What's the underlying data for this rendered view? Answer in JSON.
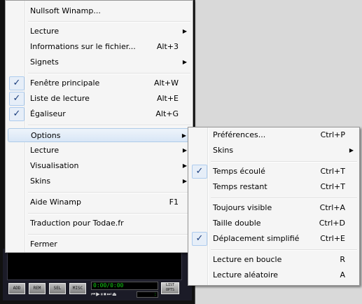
{
  "winamp": {
    "buttons": [
      "ADD",
      "REM",
      "SEL",
      "MISC"
    ],
    "time_display": "0:00/0:00",
    "list_label": "LIST OPTS"
  },
  "main_menu": {
    "items": [
      {
        "label": "Nullsoft Winamp...",
        "shortcut": "",
        "submenu": false,
        "checked": false
      },
      {
        "label": "Lecture",
        "shortcut": "",
        "submenu": true,
        "checked": false
      },
      {
        "label": "Informations sur le fichier...",
        "shortcut": "Alt+3",
        "submenu": false,
        "checked": false
      },
      {
        "label": "Signets",
        "shortcut": "",
        "submenu": true,
        "checked": false
      },
      {
        "label": "Fenêtre principale",
        "shortcut": "Alt+W",
        "submenu": false,
        "checked": true
      },
      {
        "label": "Liste de lecture",
        "shortcut": "Alt+E",
        "submenu": false,
        "checked": true
      },
      {
        "label": "Égaliseur",
        "shortcut": "Alt+G",
        "submenu": false,
        "checked": true
      },
      {
        "label": "Options",
        "shortcut": "",
        "submenu": true,
        "checked": false
      },
      {
        "label": "Lecture",
        "shortcut": "",
        "submenu": true,
        "checked": false
      },
      {
        "label": "Visualisation",
        "shortcut": "",
        "submenu": true,
        "checked": false
      },
      {
        "label": "Skins",
        "shortcut": "",
        "submenu": true,
        "checked": false
      },
      {
        "label": "Aide Winamp",
        "shortcut": "F1",
        "submenu": false,
        "checked": false
      },
      {
        "label": "Traduction pour Todae.fr",
        "shortcut": "",
        "submenu": false,
        "checked": false
      },
      {
        "label": "Fermer",
        "shortcut": "",
        "submenu": false,
        "checked": false
      }
    ]
  },
  "options_menu": {
    "items": [
      {
        "label": "Préférences...",
        "shortcut": "Ctrl+P",
        "submenu": false,
        "checked": false
      },
      {
        "label": "Skins",
        "shortcut": "",
        "submenu": true,
        "checked": false
      },
      {
        "label": "Temps écoulé",
        "shortcut": "Ctrl+T",
        "submenu": false,
        "checked": true
      },
      {
        "label": "Temps restant",
        "shortcut": "Ctrl+T",
        "submenu": false,
        "checked": false
      },
      {
        "label": "Toujours visible",
        "shortcut": "Ctrl+A",
        "submenu": false,
        "checked": false
      },
      {
        "label": "Taille double",
        "shortcut": "Ctrl+D",
        "submenu": false,
        "checked": false
      },
      {
        "label": "Déplacement simplifié",
        "shortcut": "Ctrl+E",
        "submenu": false,
        "checked": true
      },
      {
        "label": "Lecture en boucle",
        "shortcut": "R",
        "submenu": false,
        "checked": false
      },
      {
        "label": "Lecture aléatoire",
        "shortcut": "A",
        "submenu": false,
        "checked": false
      }
    ]
  },
  "icons": {
    "check": "✓",
    "submenu_arrow": "▶"
  },
  "colors": {
    "menu_bg": "#f5f5f5",
    "highlight": "#d8e6f6",
    "check_color": "#1a3d7c"
  }
}
